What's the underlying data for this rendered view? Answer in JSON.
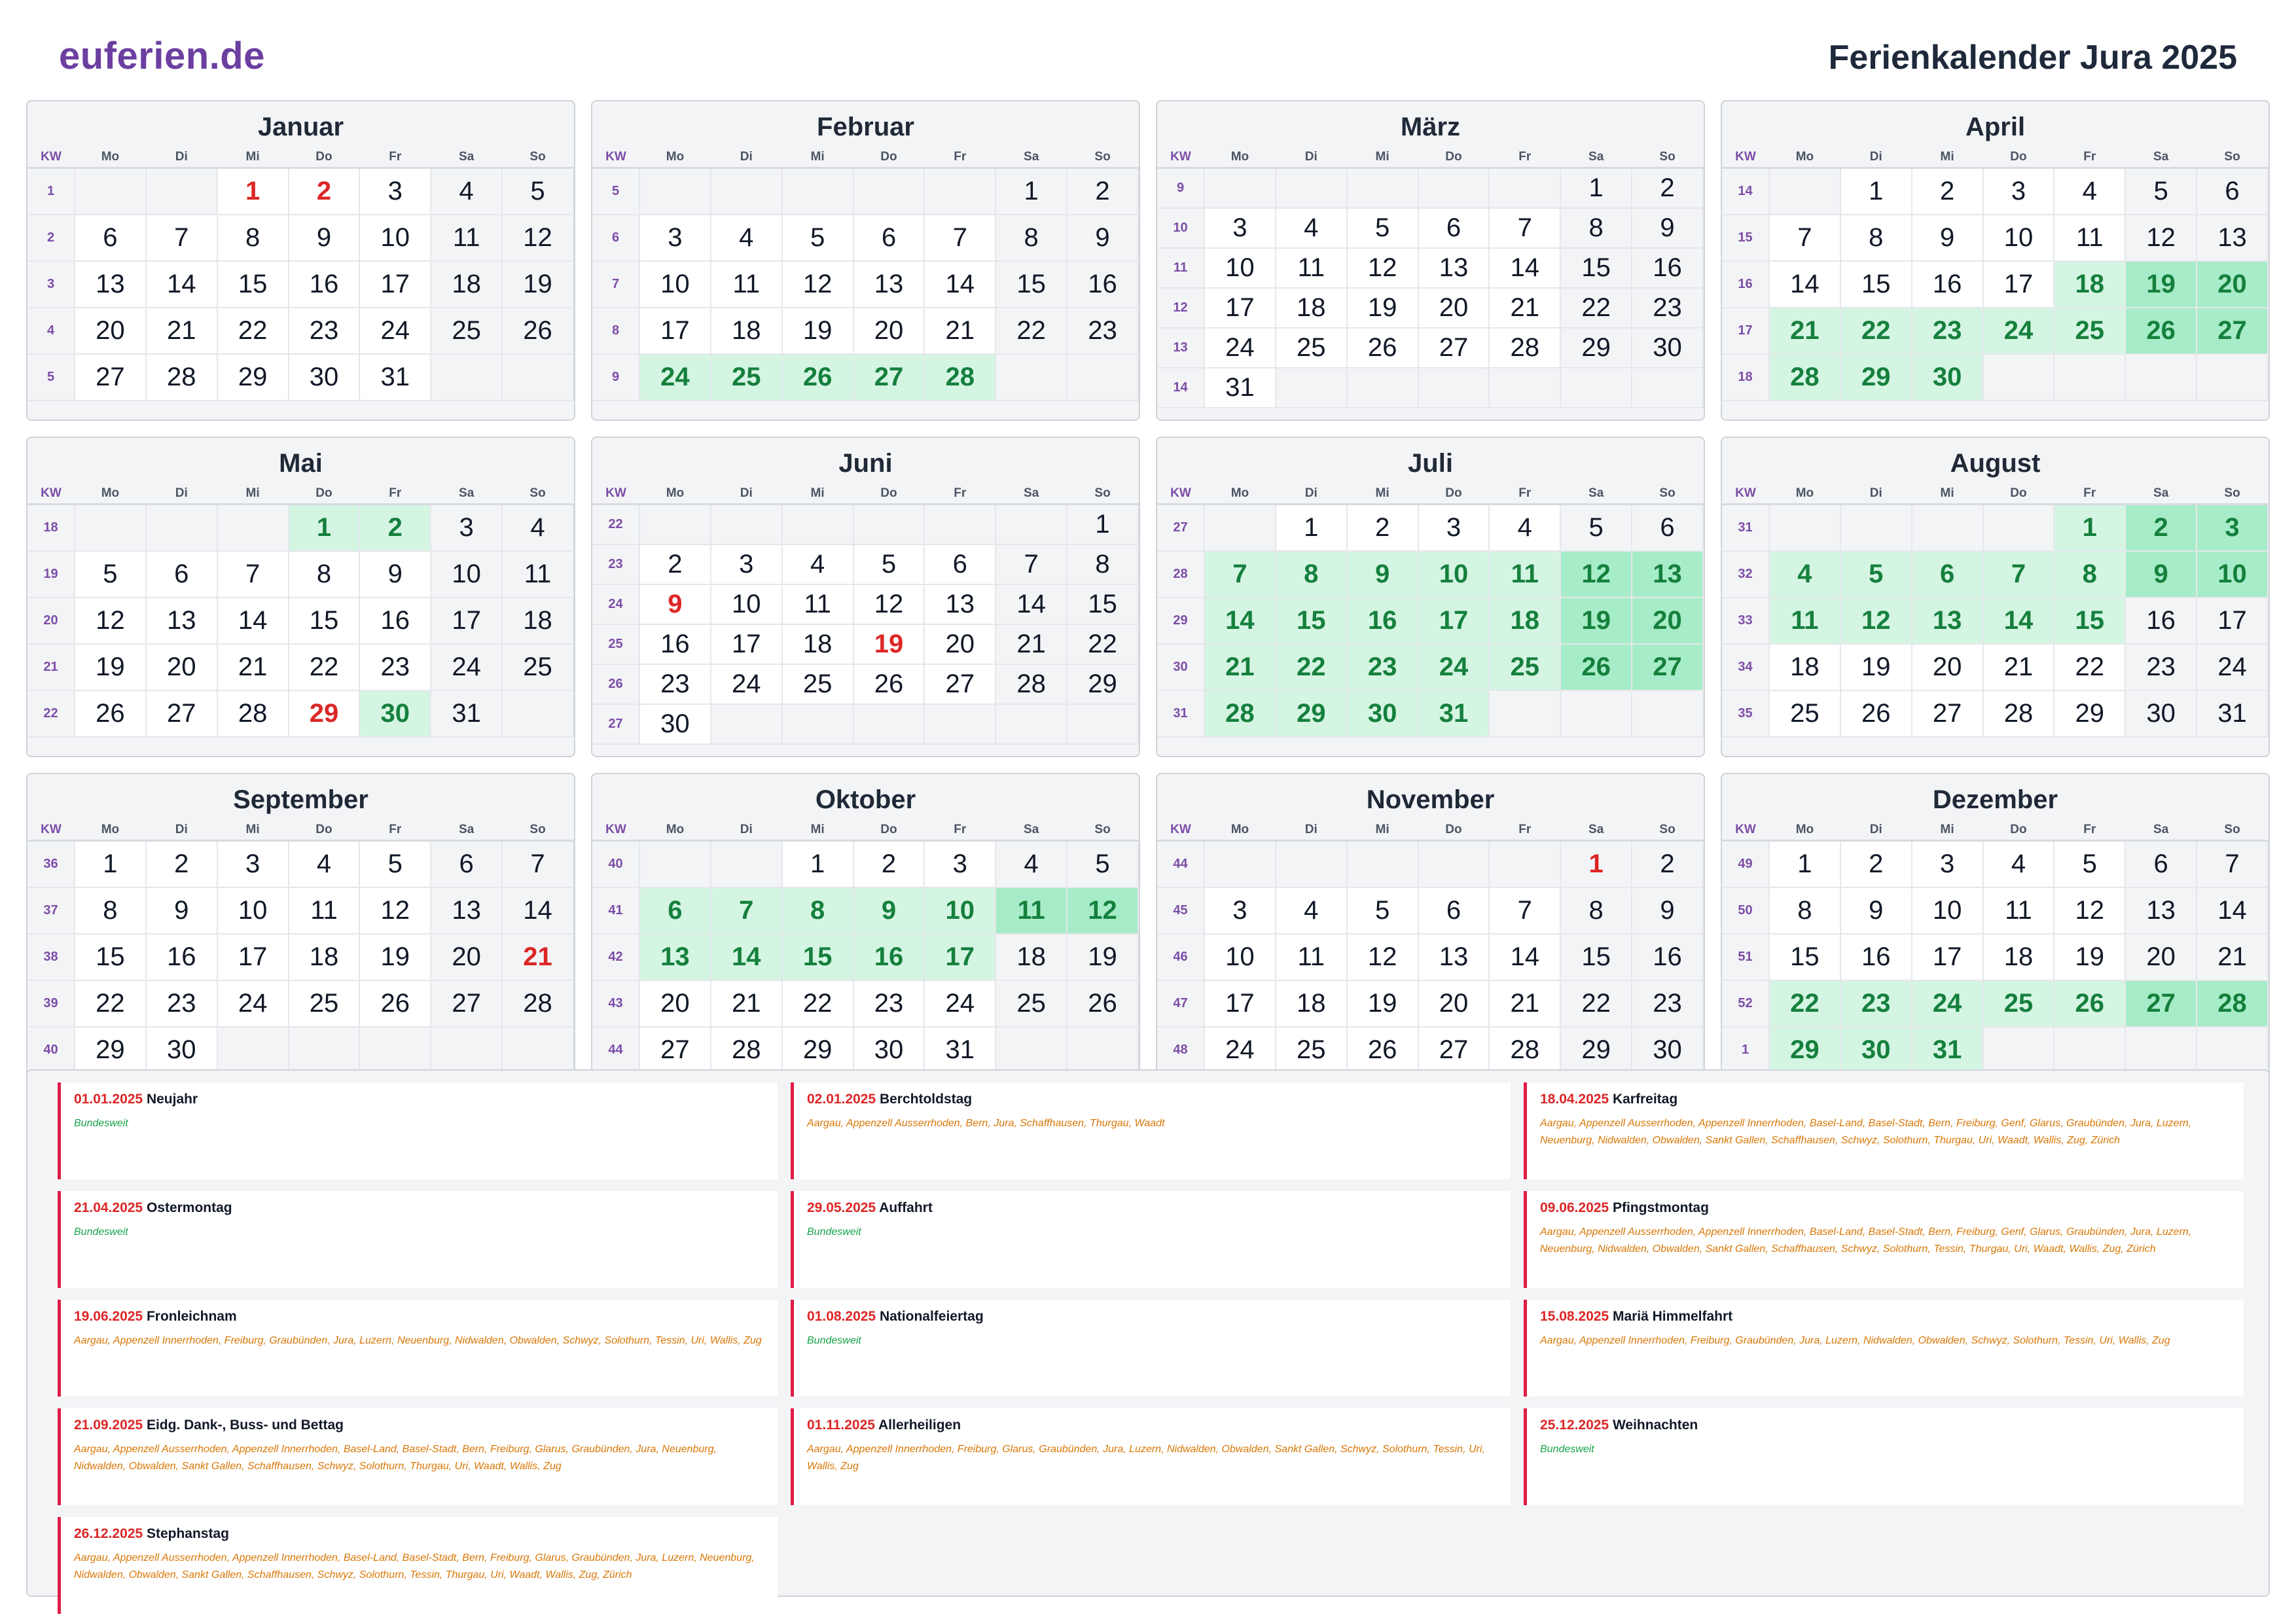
{
  "header": {
    "logo": "euferien.de",
    "title": "Ferienkalender Jura 2025"
  },
  "weekday_header": [
    "KW",
    "Mo",
    "Di",
    "Mi",
    "Do",
    "Fr",
    "Sa",
    "So"
  ],
  "colors": {
    "accent": "#6b3fa0",
    "holiday": "#dc2626",
    "vacation": "#d5f5e3",
    "vacation_weekend": "#a7ecc8",
    "regions": "#d97706",
    "nationwide": "#16a34a"
  },
  "months": [
    {
      "name": "Januar",
      "weeks": [
        {
          "kw": "1",
          "days": [
            "",
            "",
            "1",
            "2",
            "3",
            "4",
            "5"
          ]
        },
        {
          "kw": "2",
          "days": [
            "6",
            "7",
            "8",
            "9",
            "10",
            "11",
            "12"
          ]
        },
        {
          "kw": "3",
          "days": [
            "13",
            "14",
            "15",
            "16",
            "17",
            "18",
            "19"
          ]
        },
        {
          "kw": "4",
          "days": [
            "20",
            "21",
            "22",
            "23",
            "24",
            "25",
            "26"
          ]
        },
        {
          "kw": "5",
          "days": [
            "27",
            "28",
            "29",
            "30",
            "31",
            "",
            ""
          ]
        }
      ],
      "holidays": [
        "1",
        "2"
      ],
      "vacation": []
    },
    {
      "name": "Februar",
      "weeks": [
        {
          "kw": "5",
          "days": [
            "",
            "",
            "",
            "",
            "",
            "1",
            "2"
          ]
        },
        {
          "kw": "6",
          "days": [
            "3",
            "4",
            "5",
            "6",
            "7",
            "8",
            "9"
          ]
        },
        {
          "kw": "7",
          "days": [
            "10",
            "11",
            "12",
            "13",
            "14",
            "15",
            "16"
          ]
        },
        {
          "kw": "8",
          "days": [
            "17",
            "18",
            "19",
            "20",
            "21",
            "22",
            "23"
          ]
        },
        {
          "kw": "9",
          "days": [
            "24",
            "25",
            "26",
            "27",
            "28",
            "",
            ""
          ]
        }
      ],
      "holidays": [],
      "vacation": [
        "24",
        "25",
        "26",
        "27",
        "28"
      ]
    },
    {
      "name": "März",
      "weeks": [
        {
          "kw": "9",
          "days": [
            "",
            "",
            "",
            "",
            "",
            "1",
            "2"
          ]
        },
        {
          "kw": "10",
          "days": [
            "3",
            "4",
            "5",
            "6",
            "7",
            "8",
            "9"
          ]
        },
        {
          "kw": "11",
          "days": [
            "10",
            "11",
            "12",
            "13",
            "14",
            "15",
            "16"
          ]
        },
        {
          "kw": "12",
          "days": [
            "17",
            "18",
            "19",
            "20",
            "21",
            "22",
            "23"
          ]
        },
        {
          "kw": "13",
          "days": [
            "24",
            "25",
            "26",
            "27",
            "28",
            "29",
            "30"
          ]
        },
        {
          "kw": "14",
          "days": [
            "31",
            "",
            "",
            "",
            "",
            "",
            ""
          ]
        }
      ],
      "holidays": [],
      "vacation": []
    },
    {
      "name": "April",
      "weeks": [
        {
          "kw": "14",
          "days": [
            "",
            "1",
            "2",
            "3",
            "4",
            "5",
            "6"
          ]
        },
        {
          "kw": "15",
          "days": [
            "7",
            "8",
            "9",
            "10",
            "11",
            "12",
            "13"
          ]
        },
        {
          "kw": "16",
          "days": [
            "14",
            "15",
            "16",
            "17",
            "18",
            "19",
            "20"
          ]
        },
        {
          "kw": "17",
          "days": [
            "21",
            "22",
            "23",
            "24",
            "25",
            "26",
            "27"
          ]
        },
        {
          "kw": "18",
          "days": [
            "28",
            "29",
            "30",
            "",
            "",
            "",
            ""
          ]
        }
      ],
      "holidays": [
        "18",
        "21"
      ],
      "vacation": [
        "18",
        "19",
        "20",
        "21",
        "22",
        "23",
        "24",
        "25",
        "26",
        "27",
        "28",
        "29",
        "30"
      ]
    },
    {
      "name": "Mai",
      "weeks": [
        {
          "kw": "18",
          "days": [
            "",
            "",
            "",
            "1",
            "2",
            "3",
            "4"
          ]
        },
        {
          "kw": "19",
          "days": [
            "5",
            "6",
            "7",
            "8",
            "9",
            "10",
            "11"
          ]
        },
        {
          "kw": "20",
          "days": [
            "12",
            "13",
            "14",
            "15",
            "16",
            "17",
            "18"
          ]
        },
        {
          "kw": "21",
          "days": [
            "19",
            "20",
            "21",
            "22",
            "23",
            "24",
            "25"
          ]
        },
        {
          "kw": "22",
          "days": [
            "26",
            "27",
            "28",
            "29",
            "30",
            "31",
            ""
          ]
        }
      ],
      "holidays": [
        "29"
      ],
      "vacation": [
        "1",
        "2",
        "30"
      ]
    },
    {
      "name": "Juni",
      "weeks": [
        {
          "kw": "22",
          "days": [
            "",
            "",
            "",
            "",
            "",
            "",
            "1"
          ]
        },
        {
          "kw": "23",
          "days": [
            "2",
            "3",
            "4",
            "5",
            "6",
            "7",
            "8"
          ]
        },
        {
          "kw": "24",
          "days": [
            "9",
            "10",
            "11",
            "12",
            "13",
            "14",
            "15"
          ]
        },
        {
          "kw": "25",
          "days": [
            "16",
            "17",
            "18",
            "19",
            "20",
            "21",
            "22"
          ]
        },
        {
          "kw": "26",
          "days": [
            "23",
            "24",
            "25",
            "26",
            "27",
            "28",
            "29"
          ]
        },
        {
          "kw": "27",
          "days": [
            "30",
            "",
            "",
            "",
            "",
            "",
            ""
          ]
        }
      ],
      "holidays": [
        "9",
        "19"
      ],
      "vacation": []
    },
    {
      "name": "Juli",
      "weeks": [
        {
          "kw": "27",
          "days": [
            "",
            "1",
            "2",
            "3",
            "4",
            "5",
            "6"
          ]
        },
        {
          "kw": "28",
          "days": [
            "7",
            "8",
            "9",
            "10",
            "11",
            "12",
            "13"
          ]
        },
        {
          "kw": "29",
          "days": [
            "14",
            "15",
            "16",
            "17",
            "18",
            "19",
            "20"
          ]
        },
        {
          "kw": "30",
          "days": [
            "21",
            "22",
            "23",
            "24",
            "25",
            "26",
            "27"
          ]
        },
        {
          "kw": "31",
          "days": [
            "28",
            "29",
            "30",
            "31",
            "",
            "",
            ""
          ]
        }
      ],
      "holidays": [],
      "vacation": [
        "7",
        "8",
        "9",
        "10",
        "11",
        "12",
        "13",
        "14",
        "15",
        "16",
        "17",
        "18",
        "19",
        "20",
        "21",
        "22",
        "23",
        "24",
        "25",
        "26",
        "27",
        "28",
        "29",
        "30",
        "31"
      ]
    },
    {
      "name": "August",
      "weeks": [
        {
          "kw": "31",
          "days": [
            "",
            "",
            "",
            "",
            "1",
            "2",
            "3"
          ]
        },
        {
          "kw": "32",
          "days": [
            "4",
            "5",
            "6",
            "7",
            "8",
            "9",
            "10"
          ]
        },
        {
          "kw": "33",
          "days": [
            "11",
            "12",
            "13",
            "14",
            "15",
            "16",
            "17"
          ]
        },
        {
          "kw": "34",
          "days": [
            "18",
            "19",
            "20",
            "21",
            "22",
            "23",
            "24"
          ]
        },
        {
          "kw": "35",
          "days": [
            "25",
            "26",
            "27",
            "28",
            "29",
            "30",
            "31"
          ]
        }
      ],
      "holidays": [
        "1",
        "15"
      ],
      "vacation": [
        "1",
        "2",
        "3",
        "4",
        "5",
        "6",
        "7",
        "8",
        "9",
        "10",
        "11",
        "12",
        "13",
        "14",
        "15"
      ]
    },
    {
      "name": "September",
      "weeks": [
        {
          "kw": "36",
          "days": [
            "1",
            "2",
            "3",
            "4",
            "5",
            "6",
            "7"
          ]
        },
        {
          "kw": "37",
          "days": [
            "8",
            "9",
            "10",
            "11",
            "12",
            "13",
            "14"
          ]
        },
        {
          "kw": "38",
          "days": [
            "15",
            "16",
            "17",
            "18",
            "19",
            "20",
            "21"
          ]
        },
        {
          "kw": "39",
          "days": [
            "22",
            "23",
            "24",
            "25",
            "26",
            "27",
            "28"
          ]
        },
        {
          "kw": "40",
          "days": [
            "29",
            "30",
            "",
            "",
            "",
            "",
            ""
          ]
        }
      ],
      "holidays": [
        "21"
      ],
      "vacation": []
    },
    {
      "name": "Oktober",
      "weeks": [
        {
          "kw": "40",
          "days": [
            "",
            "",
            "1",
            "2",
            "3",
            "4",
            "5"
          ]
        },
        {
          "kw": "41",
          "days": [
            "6",
            "7",
            "8",
            "9",
            "10",
            "11",
            "12"
          ]
        },
        {
          "kw": "42",
          "days": [
            "13",
            "14",
            "15",
            "16",
            "17",
            "18",
            "19"
          ]
        },
        {
          "kw": "43",
          "days": [
            "20",
            "21",
            "22",
            "23",
            "24",
            "25",
            "26"
          ]
        },
        {
          "kw": "44",
          "days": [
            "27",
            "28",
            "29",
            "30",
            "31",
            "",
            ""
          ]
        }
      ],
      "holidays": [],
      "vacation": [
        "6",
        "7",
        "8",
        "9",
        "10",
        "11",
        "12",
        "13",
        "14",
        "15",
        "16",
        "17"
      ]
    },
    {
      "name": "November",
      "weeks": [
        {
          "kw": "44",
          "days": [
            "",
            "",
            "",
            "",
            "",
            "1",
            "2"
          ]
        },
        {
          "kw": "45",
          "days": [
            "3",
            "4",
            "5",
            "6",
            "7",
            "8",
            "9"
          ]
        },
        {
          "kw": "46",
          "days": [
            "10",
            "11",
            "12",
            "13",
            "14",
            "15",
            "16"
          ]
        },
        {
          "kw": "47",
          "days": [
            "17",
            "18",
            "19",
            "20",
            "21",
            "22",
            "23"
          ]
        },
        {
          "kw": "48",
          "days": [
            "24",
            "25",
            "26",
            "27",
            "28",
            "29",
            "30"
          ]
        }
      ],
      "holidays": [
        "1"
      ],
      "vacation": []
    },
    {
      "name": "Dezember",
      "weeks": [
        {
          "kw": "49",
          "days": [
            "1",
            "2",
            "3",
            "4",
            "5",
            "6",
            "7"
          ]
        },
        {
          "kw": "50",
          "days": [
            "8",
            "9",
            "10",
            "11",
            "12",
            "13",
            "14"
          ]
        },
        {
          "kw": "51",
          "days": [
            "15",
            "16",
            "17",
            "18",
            "19",
            "20",
            "21"
          ]
        },
        {
          "kw": "52",
          "days": [
            "22",
            "23",
            "24",
            "25",
            "26",
            "27",
            "28"
          ]
        },
        {
          "kw": "1",
          "days": [
            "29",
            "30",
            "31",
            "",
            "",
            "",
            ""
          ]
        }
      ],
      "holidays": [
        "25",
        "26"
      ],
      "vacation": [
        "22",
        "23",
        "24",
        "25",
        "26",
        "27",
        "28",
        "29",
        "30",
        "31"
      ]
    }
  ],
  "holiday_list": [
    {
      "date": "01.01.2025",
      "name": "Neujahr",
      "regions": "Bundesweit",
      "nationwide": true
    },
    {
      "date": "02.01.2025",
      "name": "Berchtoldstag",
      "regions": "Aargau, Appenzell Ausserrhoden, Bern, Jura, Schaffhausen, Thurgau, Waadt",
      "nationwide": false
    },
    {
      "date": "18.04.2025",
      "name": "Karfreitag",
      "regions": "Aargau, Appenzell Ausserrhoden, Appenzell Innerrhoden, Basel-Land, Basel-Stadt, Bern, Freiburg, Genf, Glarus, Graubünden, Jura, Luzern, Neuenburg, Nidwalden, Obwalden, Sankt Gallen, Schaffhausen, Schwyz, Solothurn, Thurgau, Uri, Waadt, Wallis, Zug, Zürich",
      "nationwide": false
    },
    {
      "date": "21.04.2025",
      "name": "Ostermontag",
      "regions": "Bundesweit",
      "nationwide": true
    },
    {
      "date": "29.05.2025",
      "name": "Auffahrt",
      "regions": "Bundesweit",
      "nationwide": true
    },
    {
      "date": "09.06.2025",
      "name": "Pfingstmontag",
      "regions": "Aargau, Appenzell Ausserrhoden, Appenzell Innerrhoden, Basel-Land, Basel-Stadt, Bern, Freiburg, Genf, Glarus, Graubünden, Jura, Luzern, Neuenburg, Nidwalden, Obwalden, Sankt Gallen, Schaffhausen, Schwyz, Solothurn, Tessin, Thurgau, Uri, Waadt, Wallis, Zug, Zürich",
      "nationwide": false
    },
    {
      "date": "19.06.2025",
      "name": "Fronleichnam",
      "regions": "Aargau, Appenzell Innerrhoden, Freiburg, Graubünden, Jura, Luzern, Neuenburg, Nidwalden, Obwalden, Schwyz, Solothurn, Tessin, Uri, Wallis, Zug",
      "nationwide": false
    },
    {
      "date": "01.08.2025",
      "name": "Nationalfeiertag",
      "regions": "Bundesweit",
      "nationwide": true
    },
    {
      "date": "15.08.2025",
      "name": "Mariä Himmelfahrt",
      "regions": "Aargau, Appenzell Innerrhoden, Freiburg, Graubünden, Jura, Luzern, Nidwalden, Obwalden, Schwyz, Solothurn, Tessin, Uri, Wallis, Zug",
      "nationwide": false
    },
    {
      "date": "21.09.2025",
      "name": "Eidg. Dank-, Buss- und Bettag",
      "regions": "Aargau, Appenzell Ausserrhoden, Appenzell Innerrhoden, Basel-Land, Basel-Stadt, Bern, Freiburg, Glarus, Graubünden, Jura, Neuenburg, Nidwalden, Obwalden, Sankt Gallen, Schaffhausen, Schwyz, Solothurn, Thurgau, Uri, Waadt, Wallis, Zug",
      "nationwide": false
    },
    {
      "date": "01.11.2025",
      "name": "Allerheiligen",
      "regions": "Aargau, Appenzell Innerrhoden, Freiburg, Glarus, Graubünden, Jura, Luzern, Nidwalden, Obwalden, Sankt Gallen, Schwyz, Solothurn, Tessin, Uri, Wallis, Zug",
      "nationwide": false
    },
    {
      "date": "25.12.2025",
      "name": "Weihnachten",
      "regions": "Bundesweit",
      "nationwide": true
    },
    {
      "date": "26.12.2025",
      "name": "Stephanstag",
      "regions": "Aargau, Appenzell Ausserrhoden, Appenzell Innerrhoden, Basel-Land, Basel-Stadt, Bern, Freiburg, Glarus, Graubünden, Jura, Luzern, Neuenburg, Nidwalden, Obwalden, Sankt Gallen, Schaffhausen, Schwyz, Solothurn, Tessin, Thurgau, Uri, Waadt, Wallis, Zug, Zürich",
      "nationwide": false
    }
  ]
}
